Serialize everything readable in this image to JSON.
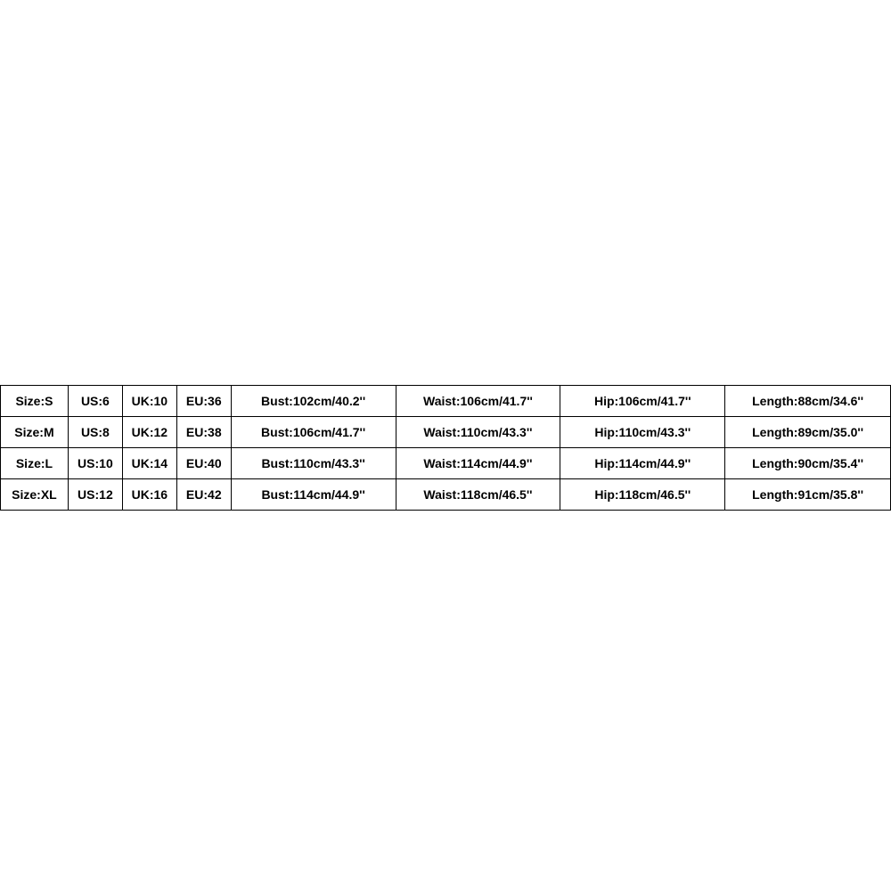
{
  "table": {
    "rows": [
      {
        "size": "Size:S",
        "us": "US:6",
        "uk": "UK:10",
        "eu": "EU:36",
        "bust": "Bust:102cm/40.2''",
        "waist": "Waist:106cm/41.7''",
        "hip": "Hip:106cm/41.7''",
        "length": "Length:88cm/34.6''"
      },
      {
        "size": "Size:M",
        "us": "US:8",
        "uk": "UK:12",
        "eu": "EU:38",
        "bust": "Bust:106cm/41.7''",
        "waist": "Waist:110cm/43.3''",
        "hip": "Hip:110cm/43.3''",
        "length": "Length:89cm/35.0''"
      },
      {
        "size": "Size:L",
        "us": "US:10",
        "uk": "UK:14",
        "eu": "EU:40",
        "bust": "Bust:110cm/43.3''",
        "waist": "Waist:114cm/44.9''",
        "hip": "Hip:114cm/44.9''",
        "length": "Length:90cm/35.4''"
      },
      {
        "size": "Size:XL",
        "us": "US:12",
        "uk": "UK:16",
        "eu": "EU:42",
        "bust": "Bust:114cm/44.9''",
        "waist": "Waist:118cm/46.5''",
        "hip": "Hip:118cm/46.5''",
        "length": "Length:91cm/35.8''"
      }
    ]
  }
}
